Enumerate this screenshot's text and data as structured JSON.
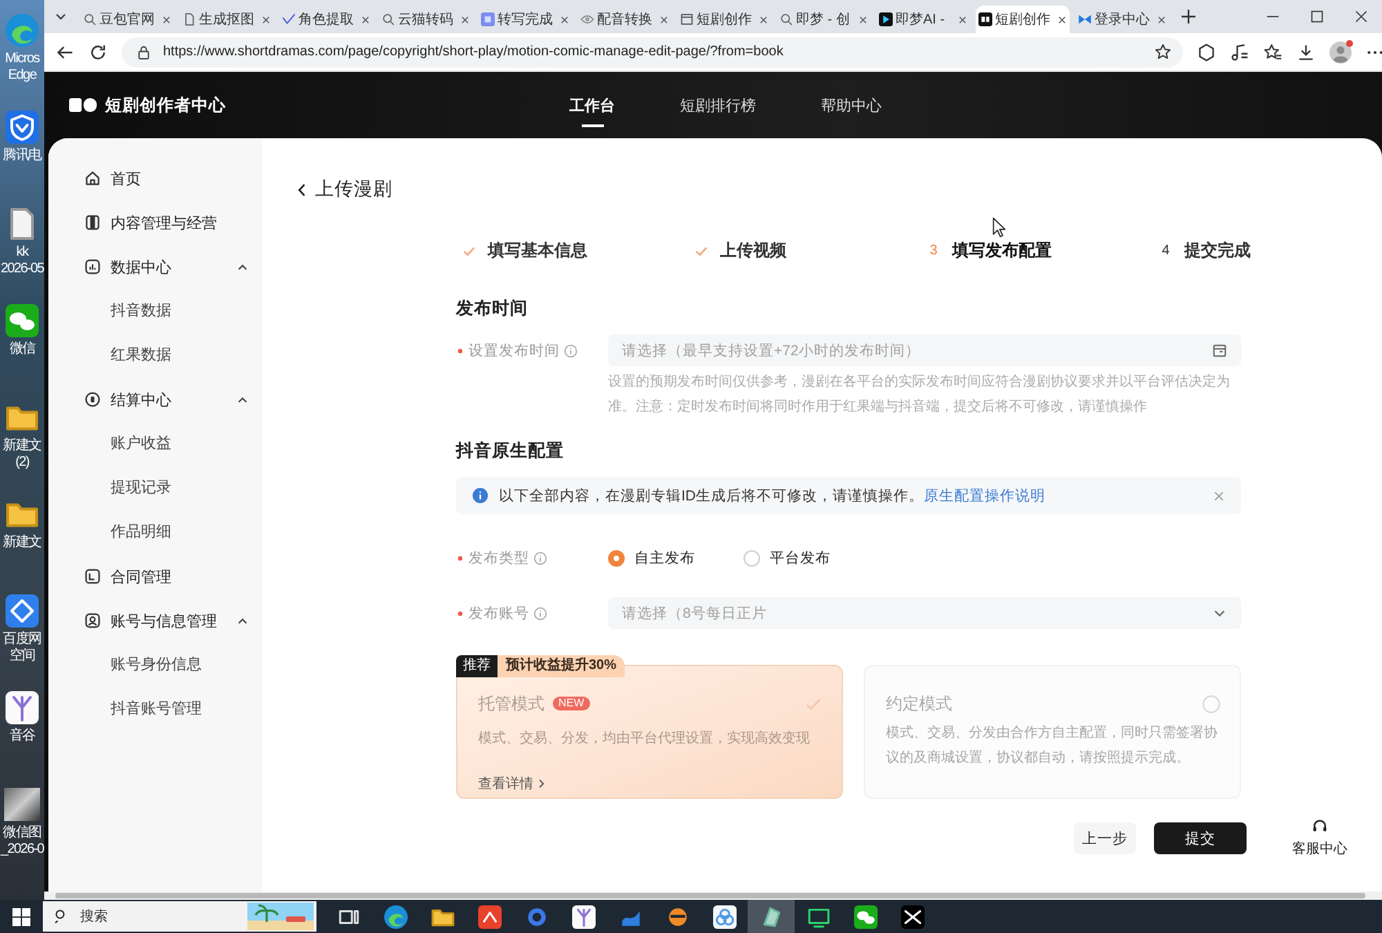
{
  "desktop": {
    "icons": [
      {
        "kind": "swirl",
        "lines": [
          "Micros",
          "Edge"
        ]
      },
      {
        "kind": "shield",
        "lines": [
          "腾讯电"
        ]
      },
      {
        "kind": "file",
        "lines": [
          "kk",
          "2026-05"
        ]
      },
      {
        "kind": "chat",
        "lines": [
          "微信"
        ]
      },
      {
        "kind": "folder",
        "lines": [
          "新建文",
          "(2)"
        ]
      },
      {
        "kind": "folder",
        "lines": [
          "新建文"
        ]
      },
      {
        "kind": "cloud",
        "lines": [
          "百度网",
          "空间"
        ]
      },
      {
        "kind": "tree",
        "lines": [
          "音谷"
        ]
      },
      {
        "kind": "photo",
        "lines": [
          "微信图",
          "_2026-0"
        ]
      }
    ]
  },
  "browser": {
    "tabs": [
      {
        "kind": "search",
        "title": "豆包官网",
        "selected": false
      },
      {
        "kind": "page",
        "title": "生成抠图",
        "selected": false
      },
      {
        "kind": "vmark",
        "title": "角色提取",
        "selected": false
      },
      {
        "kind": "search",
        "title": "云猫转码",
        "selected": false
      },
      {
        "kind": "square",
        "title": "转写完成",
        "selected": false
      },
      {
        "kind": "eye",
        "title": "配音转换",
        "selected": false
      },
      {
        "kind": "frame",
        "title": "短剧创作",
        "selected": false
      },
      {
        "kind": "search",
        "title": "即梦 - 创",
        "selected": false
      },
      {
        "kind": "spark",
        "title": "即梦AI -",
        "selected": false
      },
      {
        "kind": "black",
        "title": "短剧创作",
        "selected": true
      },
      {
        "kind": "bow",
        "title": "登录中心",
        "selected": false
      }
    ],
    "url": "https://www.shortdramas.com/page/copyright/short-play/motion-comic-manage-edit-page/?from=book"
  },
  "page_header": {
    "logo": "短剧创作者中心",
    "nav": [
      {
        "label": "工作台",
        "selected": true
      },
      {
        "label": "短剧排行榜",
        "selected": false
      },
      {
        "label": "帮助中心",
        "selected": false
      }
    ]
  },
  "sidebar": {
    "items": [
      {
        "kind": "home",
        "label": "首页"
      },
      {
        "kind": "content",
        "label": "内容管理与经营"
      },
      {
        "kind": "data",
        "label": "数据中心",
        "expanded": true,
        "children": [
          {
            "label": "抖音数据"
          },
          {
            "label": "红果数据"
          }
        ]
      },
      {
        "kind": "coin",
        "label": "结算中心",
        "expanded": true,
        "children": [
          {
            "label": "账户收益"
          },
          {
            "label": "提现记录"
          },
          {
            "label": "作品明细"
          }
        ]
      },
      {
        "kind": "contract",
        "label": "合同管理"
      },
      {
        "kind": "account",
        "label": "账号与信息管理",
        "expanded": true,
        "children": [
          {
            "label": "账号身份信息"
          },
          {
            "label": "抖音账号管理"
          }
        ]
      }
    ]
  },
  "editor": {
    "back": "上传漫剧",
    "steps": [
      {
        "completed": true,
        "selected": false,
        "label": "填写基本信息"
      },
      {
        "completed": true,
        "selected": false,
        "label": "上传视频"
      },
      {
        "completed": false,
        "selected": true,
        "number": "3",
        "label": "填写发布配置"
      },
      {
        "completed": false,
        "selected": false,
        "number": "4",
        "label": "提交完成"
      }
    ]
  },
  "publish_time": {
    "title": "发布时间",
    "field": {
      "label": "设置发布时间",
      "required": true,
      "placeholder": "请选择（最早支持设置+72小时的发布时间）"
    },
    "help": "设置的预期发布时间仅供参考，漫剧在各平台的实际发布时间应符合漫剧协议要求并以平台评估决定为准。注意：定时发布时间将同时作用于红果端与抖音端，提交后将不可修改，请谨慎操作"
  },
  "native_config": {
    "title": "抖音原生配置",
    "alert": {
      "text": "以下全部内容，在漫剧专辑ID生成后将不可修改，请谨慎操作。",
      "link": "原生配置操作说明"
    },
    "publish_type": {
      "label": "发布类型",
      "required": true,
      "options": [
        {
          "label": "自主发布",
          "selected": true
        },
        {
          "label": "平台发布",
          "selected": false
        }
      ]
    },
    "account": {
      "label": "发布账号",
      "required": true,
      "placeholder": "请选择（8号每日正片"
    },
    "modes": [
      {
        "tag": "推荐",
        "ribbon": "预计收益提升30%",
        "title": "托管模式",
        "badge": "NEW",
        "description": "模式、交易、分发，均由平台代理设置，实现高效变现",
        "link": "查看详情",
        "selected": true
      },
      {
        "title": "约定模式",
        "description": "模式、交易、分发由合作方自主配置，同时只需签署协议的及商城设置，协议都自动，请按照提示完成。",
        "selected": false
      }
    ]
  },
  "footer": {
    "buttons": [
      {
        "kind": "secondary",
        "label": "上一步"
      },
      {
        "kind": "primary",
        "label": "提交"
      }
    ],
    "support": "客服中心"
  },
  "taskbar": {
    "search_placeholder": "搜索",
    "apps": [
      {
        "kind": "taskview",
        "selected": false
      },
      {
        "kind": "swirl",
        "selected": false
      },
      {
        "kind": "folder",
        "selected": false
      },
      {
        "kind": "zigzag",
        "selected": false
      },
      {
        "kind": "ring",
        "selected": false
      },
      {
        "kind": "tree",
        "selected": false
      },
      {
        "kind": "wave",
        "selected": false
      },
      {
        "kind": "orange",
        "selected": false
      },
      {
        "kind": "rings3",
        "selected": false
      },
      {
        "kind": "glass",
        "selected": true
      },
      {
        "kind": "monitor",
        "selected": false
      },
      {
        "kind": "chat",
        "selected": false
      },
      {
        "kind": "bowtie",
        "selected": false
      }
    ]
  }
}
